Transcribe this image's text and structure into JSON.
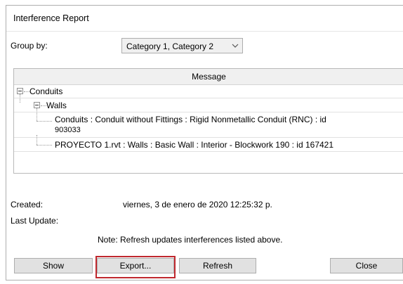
{
  "window": {
    "title": "Interference Report"
  },
  "group_by": {
    "label": "Group by:",
    "value": "Category 1, Category 2"
  },
  "table": {
    "header": "Message",
    "tree": {
      "category": "Conduits",
      "subcategory": "Walls",
      "item1_line1": "Conduits : Conduit without Fittings : Rigid Nonmetallic Conduit (RNC) : id",
      "item1_line2": "903033",
      "item2": "PROYECTO 1.rvt : Walls : Basic Wall : Interior - Blockwork 190 : id 167421"
    }
  },
  "info": {
    "created_label": "Created:",
    "created_value": "viernes, 3 de enero de 2020 12:25:32 p.",
    "last_update_label": "Last Update:",
    "note": "Note: Refresh updates interferences listed above."
  },
  "buttons": {
    "show": "Show",
    "export": "Export...",
    "refresh": "Refresh",
    "close": "Close"
  },
  "colors": {
    "highlight": "#c0282e"
  }
}
